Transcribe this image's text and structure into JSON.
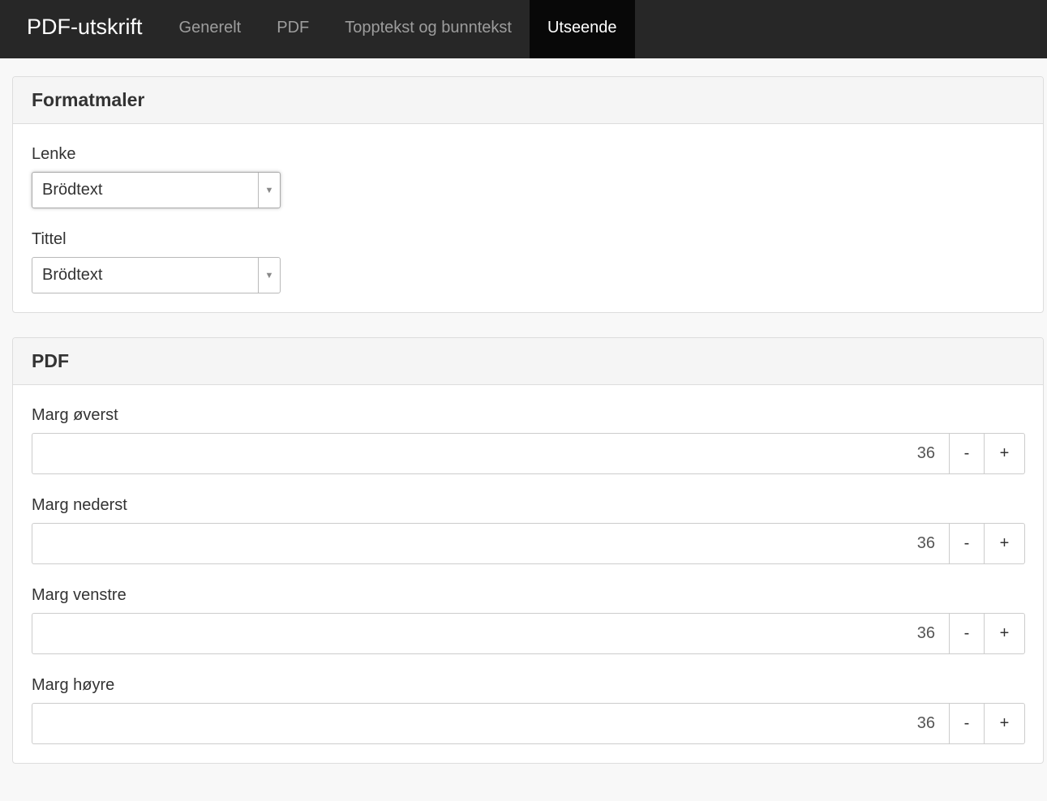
{
  "navbar": {
    "brand": "PDF-utskrift",
    "tabs": [
      {
        "label": "Generelt",
        "active": false
      },
      {
        "label": "PDF",
        "active": false
      },
      {
        "label": "Topptekst og bunntekst",
        "active": false
      },
      {
        "label": "Utseende",
        "active": true
      }
    ]
  },
  "styles_panel": {
    "heading": "Formatmaler",
    "fields": [
      {
        "label": "Lenke",
        "value": "Brödtext"
      },
      {
        "label": "Tittel",
        "value": "Brödtext"
      }
    ]
  },
  "pdf_panel": {
    "heading": "PDF",
    "fields": [
      {
        "label": "Marg øverst",
        "value": "36"
      },
      {
        "label": "Marg nederst",
        "value": "36"
      },
      {
        "label": "Marg venstre",
        "value": "36"
      },
      {
        "label": "Marg høyre",
        "value": "36"
      }
    ],
    "minus_label": "-",
    "plus_label": "+"
  },
  "icons": {
    "dropdown_arrow": "caret-down-icon"
  }
}
